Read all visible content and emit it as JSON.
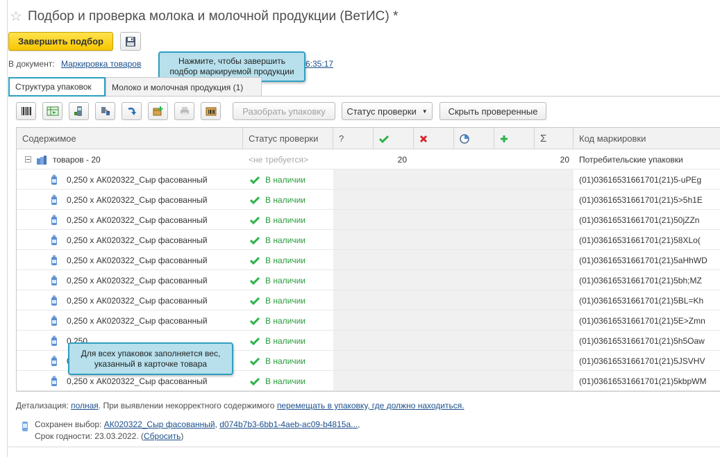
{
  "window": {
    "title": "Подбор и проверка молока и молочной продукции (ВетИС) *"
  },
  "actions": {
    "finish_label": "Завершить подбор"
  },
  "document": {
    "label": "В документ:",
    "link_text": "Маркировка товаров",
    "link_tail": "6:35:17"
  },
  "callouts": {
    "finish_hint": "Нажмите, чтобы завершить подбор маркируемой продукции",
    "weight_hint": "Для всех упаковок заполняется вес, указанный в карточке товара"
  },
  "tabs": [
    {
      "label": "Структура упаковок"
    },
    {
      "label": "Молоко и молочная продукция (1)"
    }
  ],
  "toolbar": {
    "unpack_label": "Разобрать упаковку",
    "status_label": "Статус проверки",
    "hide_checked_label": "Скрыть проверенные"
  },
  "grid": {
    "headers": {
      "content": "Содержимое",
      "status": "Статус проверки",
      "unknown": "?",
      "code": "Код маркировки"
    },
    "group": {
      "label": "товаров - 20",
      "status": "<не требуется>",
      "ok_count": "20",
      "total": "20",
      "code": "Потребительские упаковки"
    },
    "rows": [
      {
        "item": "0,250 x АК020322_Сыр фасованный",
        "status": "В наличии",
        "code": "(01)03616531661701(21)5-uPEg"
      },
      {
        "item": "0,250 x АК020322_Сыр фасованный",
        "status": "В наличии",
        "code": "(01)03616531661701(21)5>5h1E"
      },
      {
        "item": "0,250 x АК020322_Сыр фасованный",
        "status": "В наличии",
        "code": "(01)03616531661701(21)50jZZn"
      },
      {
        "item": "0,250 x АК020322_Сыр фасованный",
        "status": "В наличии",
        "code": "(01)03616531661701(21)58XLo("
      },
      {
        "item": "0,250 x АК020322_Сыр фасованный",
        "status": "В наличии",
        "code": "(01)03616531661701(21)5aHhWD"
      },
      {
        "item": "0,250 x АК020322_Сыр фасованный",
        "status": "В наличии",
        "code": "(01)03616531661701(21)5bh;MZ"
      },
      {
        "item": "0,250 x АК020322_Сыр фасованный",
        "status": "В наличии",
        "code": "(01)03616531661701(21)5BL=Kh"
      },
      {
        "item": "0,250 x АК020322_Сыр фасованный",
        "status": "В наличии",
        "code": "(01)03616531661701(21)5E>Zmn"
      },
      {
        "item": "0,250",
        "status": "В наличии",
        "code": "(01)03616531661701(21)5h5Oaw"
      },
      {
        "item": "0,2",
        "status": "В наличии",
        "code": "(01)03616531661701(21)5JSVHV"
      },
      {
        "item": "0,250 x АК020322_Сыр фасованный",
        "status": "В наличии",
        "code": "(01)03616531661701(21)5kbpWM"
      }
    ]
  },
  "footer": {
    "detail_label": "Детализация:",
    "detail_link": "полная",
    "detail_text": ". При выявлении некорректного содержимого",
    "move_link": "перемещать в упаковку, где должно находиться.",
    "saved_label": "Сохранен выбор:",
    "saved_item_link": "АК020322_Сыр фасованный",
    "saved_sep": ",",
    "saved_id_link": "d074b7b3-6bb1-4aeb-ac09-b4815a...",
    "saved_tail": ",",
    "expiry_label": "Срок годности: 23.03.2022. (",
    "reset_link": "Сбросить",
    "expiry_close": ")"
  },
  "colors": {
    "accent": "#2f9fc0",
    "primary_button": "#f7c600",
    "ok_green": "#2db24a",
    "error_red": "#d9262b",
    "link": "#1c4f8c"
  }
}
